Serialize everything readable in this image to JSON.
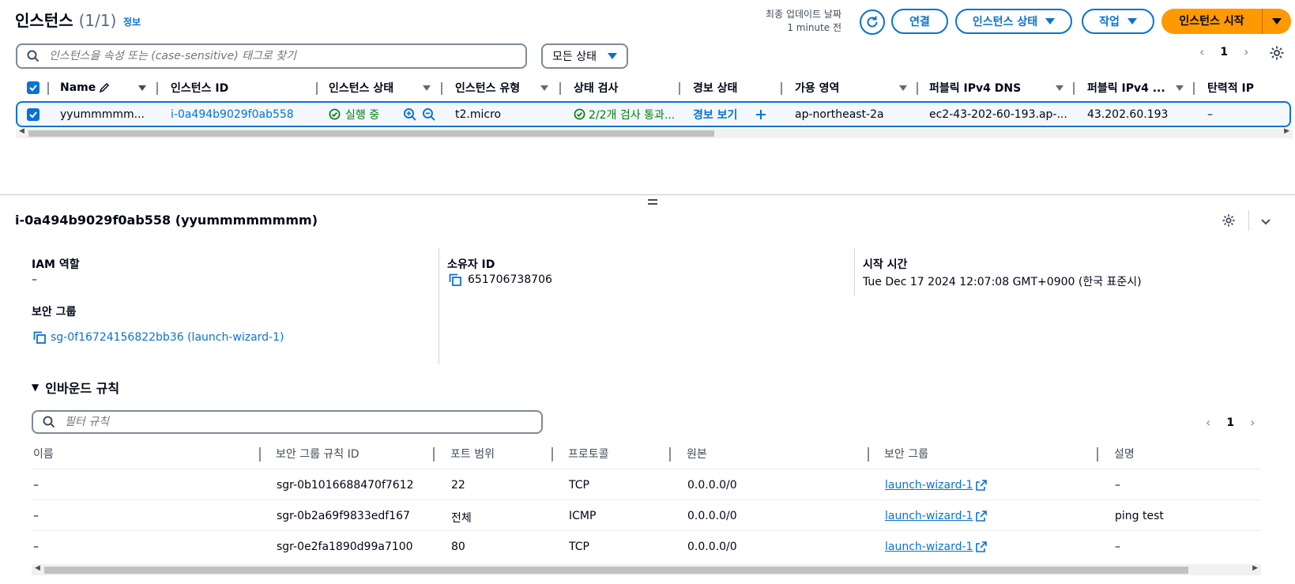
{
  "header": {
    "title": "인스턴스",
    "count": "(1/1)",
    "info_link": "정보",
    "last_updated_label": "최종 업데이트 날짜",
    "last_updated_value": "1 minute 전",
    "buttons": {
      "connect": "연결",
      "instance_state": "인스턴스 상태",
      "actions": "작업",
      "launch": "인스턴스 시작"
    }
  },
  "search": {
    "placeholder": "인스턴스을 속성 또는 (case-sensitive) 태그로 찾기",
    "filter_select": "모든 상태"
  },
  "pagination": {
    "page": "1"
  },
  "table": {
    "columns": [
      "Name",
      "인스턴스 ID",
      "인스턴스 상태",
      "인스턴스 유형",
      "상태 검사",
      "경보 상태",
      "가용 영역",
      "퍼블릭 IPv4 DNS",
      "퍼블릭 IPv4 ...",
      "탄력적 IP"
    ],
    "row": {
      "name": "yyummmmm...",
      "instance_id": "i-0a494b9029f0ab558",
      "state": "실행 중",
      "type": "t2.micro",
      "status_check": "2/2개 검사 통과...",
      "alarm": "경보 보기",
      "az": "ap-northeast-2a",
      "public_dns": "ec2-43-202-60-193.ap-...",
      "public_ip": "43.202.60.193",
      "elastic_ip": "–"
    }
  },
  "details": {
    "title": "i-0a494b9029f0ab558 (yyummmmmmmm)",
    "iam_label": "IAM 역할",
    "iam_value": "–",
    "owner_label": "소유자 ID",
    "owner_value": "651706738706",
    "launch_label": "시작 시간",
    "launch_value": "Tue Dec 17 2024 12:07:08 GMT+0900 (한국 표준시)",
    "sg_label": "보안 그룹",
    "sg_value": "sg-0f16724156822bb36 (launch-wizard-1)"
  },
  "inbound": {
    "title": "인바운드 규칙",
    "filter_placeholder": "필터 규칙",
    "page": "1",
    "columns": [
      "이름",
      "보안 그룹 규칙 ID",
      "포트 범위",
      "프로토콜",
      "원본",
      "보안 그룹",
      "설명"
    ],
    "rows": [
      {
        "name": "–",
        "rule_id": "sgr-0b1016688470f7612",
        "port": "22",
        "protocol": "TCP",
        "source": "0.0.0.0/0",
        "sg": "launch-wizard-1",
        "desc": "–"
      },
      {
        "name": "–",
        "rule_id": "sgr-0b2a69f9833edf167",
        "port": "전체",
        "protocol": "ICMP",
        "source": "0.0.0.0/0",
        "sg": "launch-wizard-1",
        "desc": "ping test"
      },
      {
        "name": "–",
        "rule_id": "sgr-0e2fa1890d99a7100",
        "port": "80",
        "protocol": "TCP",
        "source": "0.0.0.0/0",
        "sg": "launch-wizard-1",
        "desc": "–"
      }
    ]
  },
  "colors": {
    "link": "#0972d3",
    "primary": "#ff9900",
    "success": "#037f0c"
  }
}
